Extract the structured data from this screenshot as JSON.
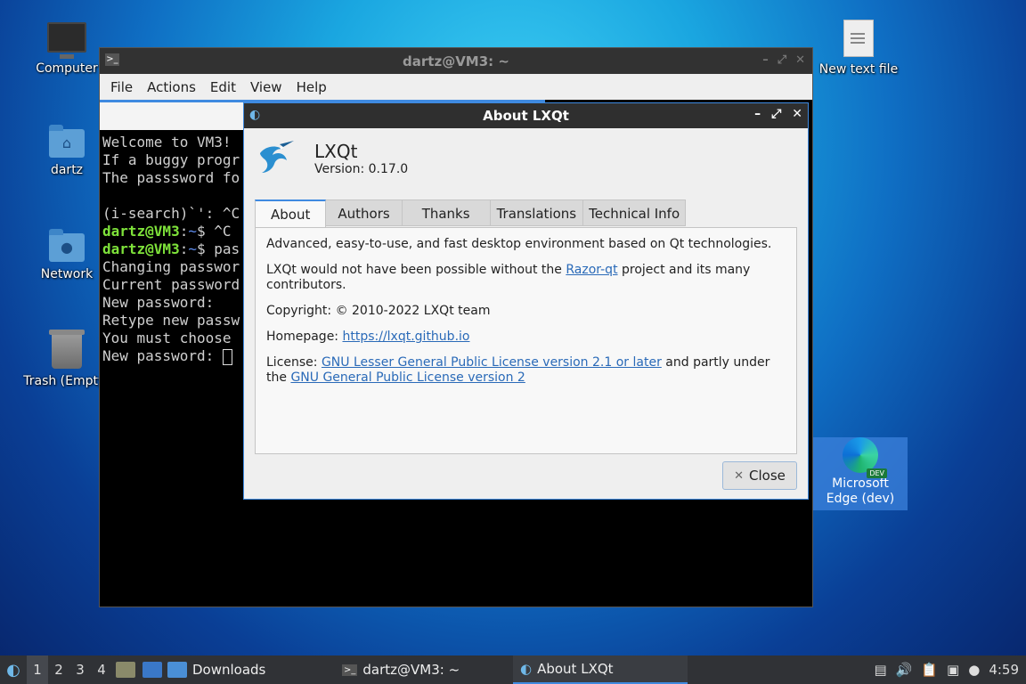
{
  "desktop": {
    "icons": [
      {
        "label": "Computer"
      },
      {
        "label": "dartz"
      },
      {
        "label": "Network"
      },
      {
        "label": "Trash (Empty)"
      },
      {
        "label": "New text file"
      },
      {
        "label": "Microsoft Edge (dev)",
        "badge": "DEV"
      }
    ]
  },
  "terminal": {
    "title": "dartz@VM3: ~",
    "menu": [
      "File",
      "Actions",
      "Edit",
      "View",
      "Help"
    ],
    "lines": [
      "Welcome to VM3!",
      "If a buggy progr",
      "The passsword fo",
      "",
      "(i-search)`': ^C",
      "Changing passwor",
      "Current password",
      "New password:",
      "Retype new passw",
      "You must choose",
      "New password: "
    ],
    "prompt_user": "dartz@VM3",
    "prompt_path": "~",
    "prompt_cmd_1": "$ ^C",
    "prompt_cmd_2": "$ pas"
  },
  "about": {
    "title": "About LXQt",
    "app_name": "LXQt",
    "version": "Version: 0.17.0",
    "tabs": [
      "About",
      "Authors",
      "Thanks",
      "Translations",
      "Technical Info"
    ],
    "active_tab": "About",
    "description": "Advanced, easy-to-use, and fast desktop environment based on Qt technologies.",
    "razor_pre": "LXQt would not have been possible without the ",
    "razor_link": "Razor-qt",
    "razor_post": " project and its many contributors.",
    "copyright": "Copyright: © 2010-2022 LXQt team",
    "homepage_label": "Homepage: ",
    "homepage_link": "https://lxqt.github.io",
    "license_label": "License: ",
    "license_link_1": "GNU Lesser General Public License version 2.1 or later",
    "license_mid": " and partly under the ",
    "license_link_2": "GNU General Public License version 2",
    "close_label": "Close"
  },
  "taskbar": {
    "workspaces": [
      "1",
      "2",
      "3",
      "4"
    ],
    "active_workspace": "1",
    "tasks": [
      {
        "label": "Downloads"
      },
      {
        "label": "dartz@VM3: ~"
      },
      {
        "label": "About LXQt"
      }
    ],
    "clock": "4:59"
  }
}
